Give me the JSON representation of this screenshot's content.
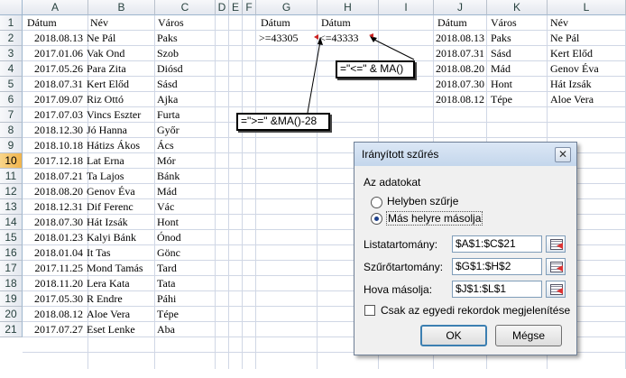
{
  "columns": [
    "A",
    "B",
    "C",
    "D",
    "E",
    "F",
    "G",
    "H",
    "I",
    "J",
    "K",
    "L"
  ],
  "rows": [
    "1",
    "2",
    "3",
    "4",
    "5",
    "6",
    "7",
    "8",
    "9",
    "10",
    "11",
    "12",
    "13",
    "14",
    "15",
    "16",
    "17",
    "18",
    "19",
    "20",
    "21"
  ],
  "active_row": "10",
  "source_table": {
    "headers": [
      "Dátum",
      "Név",
      "Város"
    ],
    "rows": [
      [
        "2018.08.13",
        "Ne Pál",
        "Paks"
      ],
      [
        "2017.01.06",
        "Vak Ond",
        "Szob"
      ],
      [
        "2017.05.26",
        "Para Zita",
        "Diósd"
      ],
      [
        "2018.07.31",
        "Kert Előd",
        "Sásd"
      ],
      [
        "2017.09.07",
        "Riz Ottó",
        "Ajka"
      ],
      [
        "2017.07.03",
        "Vincs Eszter",
        "Furta"
      ],
      [
        "2018.12.30",
        "Jó Hanna",
        "Győr"
      ],
      [
        "2018.10.18",
        "Hátizs Ákos",
        "Ács"
      ],
      [
        "2017.12.18",
        "Lat Erna",
        "Mór"
      ],
      [
        "2018.07.21",
        "Ta Lajos",
        "Bánk"
      ],
      [
        "2018.08.20",
        "Genov Éva",
        "Mád"
      ],
      [
        "2018.12.31",
        "Dif Ferenc",
        "Vác"
      ],
      [
        "2018.07.30",
        "Hát Izsák",
        "Hont"
      ],
      [
        "2018.01.23",
        "Kalyi Bánk",
        "Ónod"
      ],
      [
        "2018.01.04",
        "It Tas",
        "Gönc"
      ],
      [
        "2017.11.25",
        "Mond Tamás",
        "Tard"
      ],
      [
        "2018.11.20",
        "Lera Kata",
        "Tata"
      ],
      [
        "2017.05.30",
        "R Endre",
        "Páhi"
      ],
      [
        "2018.08.12",
        "Aloe Vera",
        "Tépe"
      ],
      [
        "2017.07.27",
        "Eset Lenke",
        "Aba"
      ]
    ]
  },
  "criteria": {
    "headers": [
      "Dátum",
      "Dátum"
    ],
    "values": [
      ">=43305",
      "<=43333"
    ]
  },
  "output_table": {
    "headers": [
      "Dátum",
      "Város",
      "Név"
    ],
    "rows": [
      [
        "2018.08.13",
        "Paks",
        "Ne Pál"
      ],
      [
        "2018.07.31",
        "Sásd",
        "Kert Előd"
      ],
      [
        "2018.08.20",
        "Mád",
        "Genov Éva"
      ],
      [
        "2018.07.30",
        "Hont",
        "Hát Izsák"
      ],
      [
        "2018.08.12",
        "Tépe",
        "Aloe Vera"
      ]
    ]
  },
  "callouts": {
    "le": "=\"<=\" & MA()",
    "ge": "=\">=\" &MA()-28"
  },
  "dialog": {
    "title": "Irányított szűrés",
    "close_glyph": "✕",
    "group_label": "Az adatokat",
    "radio_inplace": "Helyben szűrje",
    "radio_copy": "Más helyre másolja",
    "list_range_label": "Listatartomány:",
    "list_range_value": "$A$1:$C$21",
    "criteria_range_label": "Szűrőtartomány:",
    "criteria_range_value": "$G$1:$H$2",
    "copy_to_label": "Hova másolja:",
    "copy_to_value": "$J$1:$L$1",
    "unique_label": "Csak az egyedi rekordok megjelenítése",
    "ok_label": "OK",
    "cancel_label": "Mégse"
  },
  "colors": {
    "arrow_marker": "#cc2222",
    "active_row_header": "#f1b44c",
    "gridline": "#d0d7e5"
  }
}
